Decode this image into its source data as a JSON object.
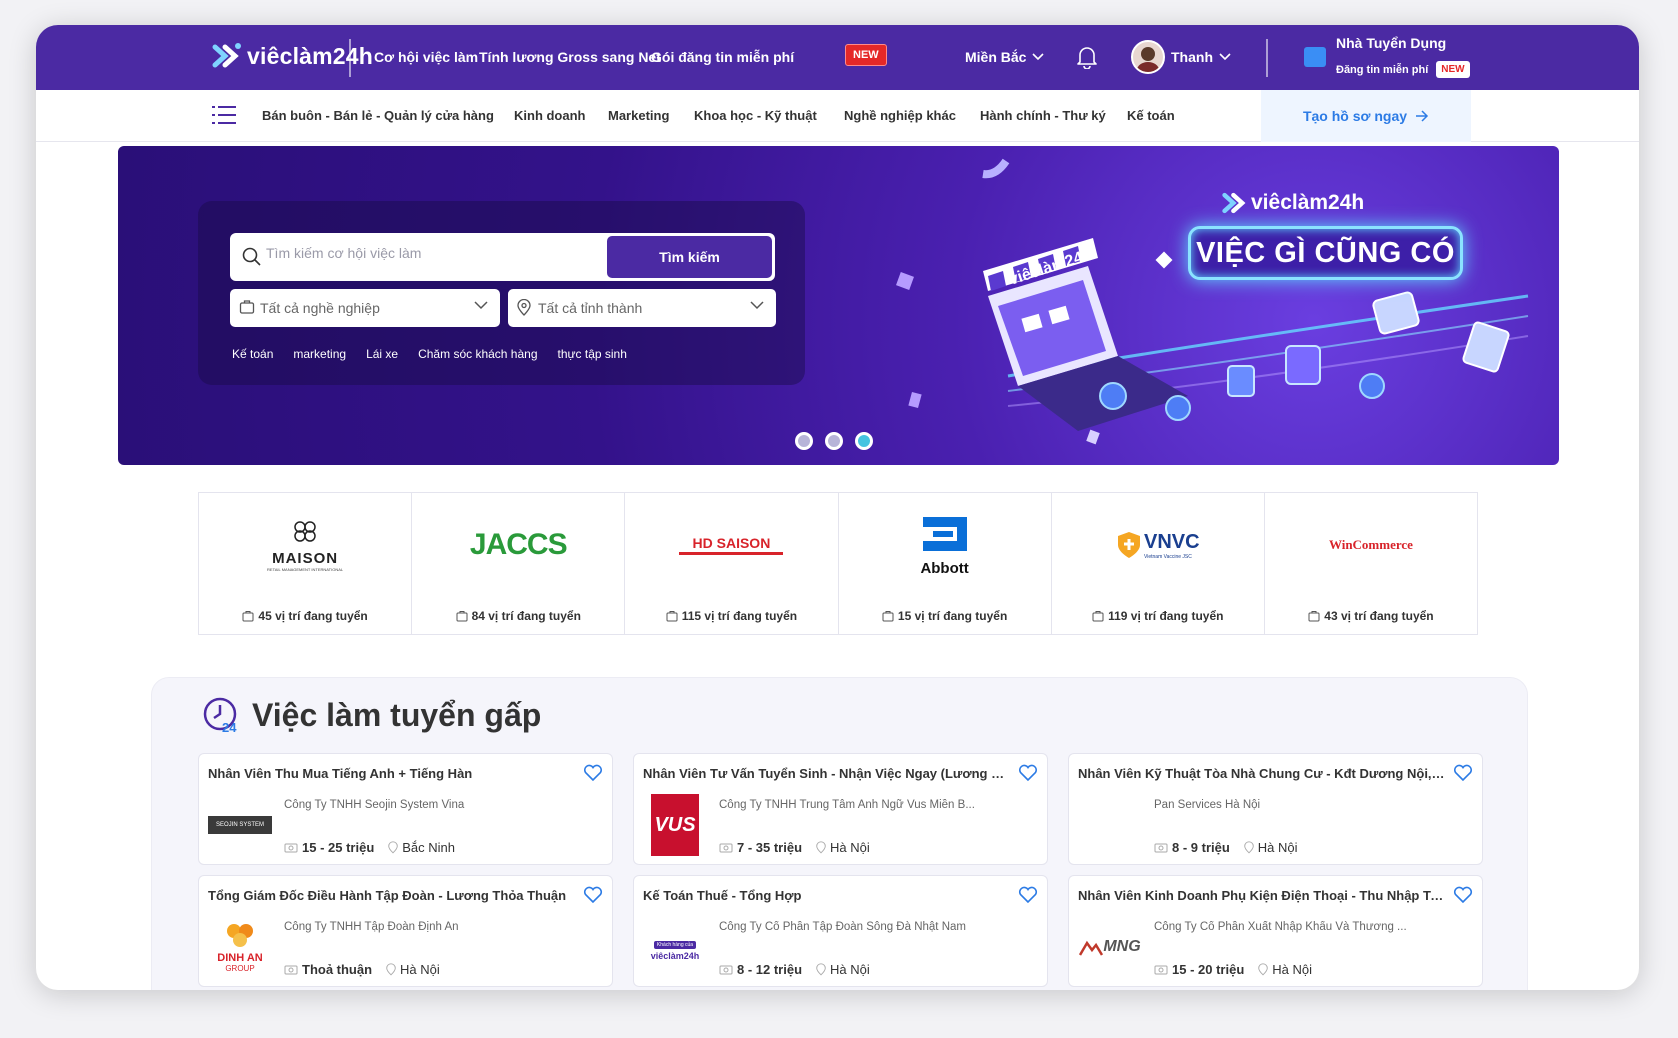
{
  "header": {
    "brand": "viêclàm24h",
    "nav": [
      "Cơ hội việc làm",
      "Tính lương Gross sang Net",
      "Gói đăng tin miễn phí"
    ],
    "new_badge": "NEW",
    "region": "Miền Bắc",
    "user_name": "Thanh",
    "employer_title": "Nhà Tuyển Dụng",
    "employer_sub": "Đăng tin miễn phí",
    "employer_badge": "NEW"
  },
  "categories": {
    "items": [
      "Bán buôn - Bán lẻ - Quản lý cửa hàng",
      "Kinh doanh",
      "Marketing",
      "Khoa học - Kỹ thuật",
      "Nghề nghiệp khác",
      "Hành chính - Thư ký",
      "Kế toán"
    ],
    "cta": "Tạo hồ sơ ngay"
  },
  "banner": {
    "search_placeholder": "Tìm kiếm cơ hội việc làm",
    "search_button": "Tìm kiếm",
    "occupation_select": "Tất cả nghề nghiệp",
    "province_select": "Tất cả tỉnh thành",
    "tags": [
      "Kế toán",
      "marketing",
      "Lái xe",
      "Chăm sóc khách hàng",
      "thực tập sinh"
    ],
    "brand": "viêclàm24h",
    "slogan": "VIỆC GÌ CŨNG CÓ",
    "illus_brand": "viêclàm24h",
    "slide_count": 3,
    "active_slide": 3
  },
  "companies": [
    {
      "name": "MAISON",
      "sub": "RETAIL MANAGEMENT INTERNATIONAL",
      "count": "45 vị trí đang tuyển"
    },
    {
      "name": "JACCS",
      "count": "84 vị trí đang tuyển"
    },
    {
      "name": "HD SAISON",
      "count": "115 vị trí đang tuyển"
    },
    {
      "name": "Abbott",
      "count": "15 vị trí đang tuyển"
    },
    {
      "name": "VNVC",
      "sub": "Vietnam Vaccine JSC",
      "count": "119 vị trí đang tuyển"
    },
    {
      "name": "WinCommerce",
      "count": "43 vị trí đang tuyển"
    }
  ],
  "urgent": {
    "title": "Việc làm tuyển gấp",
    "jobs": [
      {
        "title": "Nhân Viên Thu Mua Tiếng Anh + Tiếng Hàn",
        "company": "Công Ty TNHH Seojin System Vina",
        "salary": "15 - 25 triệu",
        "location": "Bắc Ninh",
        "logo_text": "SEOJIN SYSTEM"
      },
      {
        "title": "Nhân Viên Tư Vấn Tuyển Sinh - Nhận Việc Ngay (Lương Cứng...",
        "company": "Công Ty TNHH Trung Tâm Anh Ngữ Vus Miền B...",
        "salary": "7 - 35 triệu",
        "location": "Hà Nội",
        "logo_text": "VUS"
      },
      {
        "title": "Nhân Viên Kỹ Thuật Tòa Nhà Chung Cư - Kđt Dương Nội, Hà...",
        "company": "Pan Services Hà Nội",
        "salary": "8 - 9 triệu",
        "location": "Hà Nội",
        "logo_text": ""
      },
      {
        "title": "Tổng Giám Đốc Điều Hành Tập Đoàn - Lương Thỏa Thuận",
        "company": "Công Ty TNHH Tập Đoàn Định An",
        "salary": "Thoả thuận",
        "location": "Hà Nội",
        "logo_text": "DINH AN",
        "logo_sub": "GROUP"
      },
      {
        "title": "Kế Toán Thuế - Tổng Hợp",
        "company": "Công Ty Cổ Phần Tập Đoàn Sông Đà Nhật Nam",
        "salary": "8 - 12 triệu",
        "location": "Hà Nội",
        "logo_text": "viêclàm24h",
        "logo_sub": "Khách hàng của"
      },
      {
        "title": "Nhân Viên Kinh Doanh Phụ Kiện Điện Thoại - Thu Nhập Trên...",
        "company": "Công Ty Cổ Phần Xuất Nhập Khẩu Và Thương ...",
        "salary": "15 - 20 triệu",
        "location": "Hà Nội",
        "logo_text": "MNG"
      }
    ]
  },
  "colors": {
    "primary": "#4b2aa3",
    "accent_blue": "#2c7be5",
    "badge_red": "#e52828",
    "slogan_glow": "#8be3ff"
  }
}
